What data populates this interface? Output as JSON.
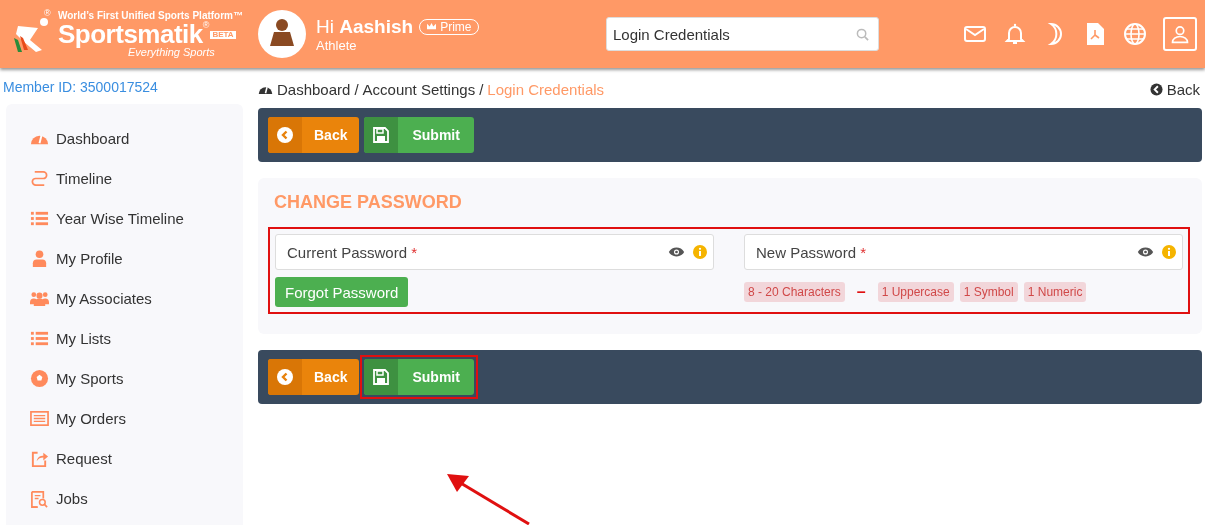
{
  "header": {
    "logo": {
      "tagline": "World’s First Unified Sports Platform™",
      "reg_mark": "®",
      "name": "Sportsmatik",
      "name_mark": "®",
      "badge": "BETA",
      "slogan": "Everything Sports"
    },
    "user": {
      "greeting": "Hi",
      "name": "Aashish",
      "badge": "Prime",
      "role": "Athlete"
    },
    "search": {
      "value": "Login Credentials"
    },
    "icons": [
      {
        "kind": "mail"
      },
      {
        "kind": "bell"
      },
      {
        "kind": "moon"
      },
      {
        "kind": "pdf"
      },
      {
        "kind": "globe"
      },
      {
        "kind": "user"
      }
    ]
  },
  "member_id": "Member ID: 3500017524",
  "sidebar": {
    "items": [
      {
        "label": "Dashboard"
      },
      {
        "label": "Timeline"
      },
      {
        "label": "Year Wise Timeline"
      },
      {
        "label": "My Profile"
      },
      {
        "label": "My Associates"
      },
      {
        "label": "My Lists"
      },
      {
        "label": "My Sports"
      },
      {
        "label": "My Orders"
      },
      {
        "label": "Request"
      },
      {
        "label": "Jobs"
      }
    ]
  },
  "breadcrumb": [
    {
      "kind": "link",
      "text": "Dashboard"
    },
    {
      "kind": "separator",
      "text": "/"
    },
    {
      "kind": "link",
      "text": "Account Settings"
    },
    {
      "kind": "separator",
      "text": "/"
    },
    {
      "kind": "current",
      "text": "Login Credentials"
    }
  ],
  "back_link": "Back",
  "toolbars": [
    {
      "buttons": [
        {
          "kind": "back",
          "label": "Back",
          "highlighted": false
        },
        {
          "kind": "submit",
          "label": "Submit",
          "highlighted": false
        }
      ]
    },
    {
      "buttons": [
        {
          "kind": "back",
          "label": "Back",
          "highlighted": false
        },
        {
          "kind": "submit",
          "label": "Submit",
          "highlighted": true
        }
      ]
    }
  ],
  "section": {
    "title": "CHANGE PASSWORD",
    "highlighted": true,
    "fields": [
      {
        "placeholder": "Current Password",
        "required": "*"
      },
      {
        "placeholder": "New Password",
        "required": "*"
      }
    ],
    "forgot_button": "Forgot Password",
    "rules": [
      {
        "kind": "tag",
        "text": "8 - 20 Characters"
      },
      {
        "kind": "dash",
        "text": "–"
      },
      {
        "kind": "tag",
        "text": "1 Uppercase"
      },
      {
        "kind": "tag",
        "text": "1 Symbol"
      },
      {
        "kind": "tag",
        "text": "1 Numeric"
      }
    ]
  }
}
